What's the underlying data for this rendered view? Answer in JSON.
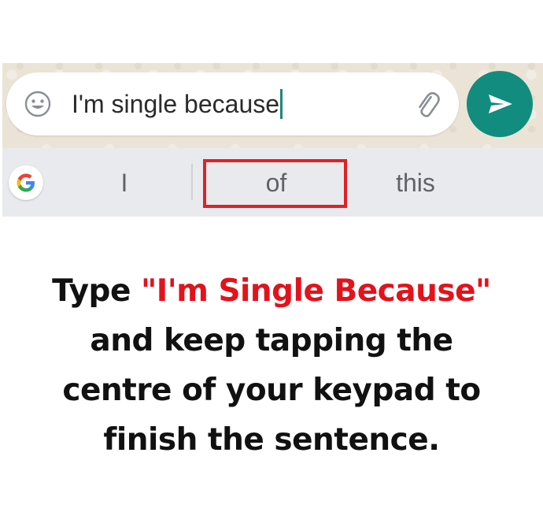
{
  "composer": {
    "text": "I'm single because",
    "icons": [
      "emoji-icon",
      "paperclip-icon",
      "send-icon"
    ],
    "send_color": "#128c7e",
    "caret_color": "#1b8a7a"
  },
  "suggestions": {
    "logo": "google-g-icon",
    "items": [
      "I",
      "of",
      "this"
    ],
    "highlighted_index": 1,
    "highlight_color": "#e02027"
  },
  "caption": {
    "prefix": "Type ",
    "highlight": "\"I'm Single Because\"",
    "line2": "and keep tapping the",
    "line3": "centre of your keypad to",
    "line4": "finish the sentence.",
    "highlight_color": "#e3121b"
  }
}
